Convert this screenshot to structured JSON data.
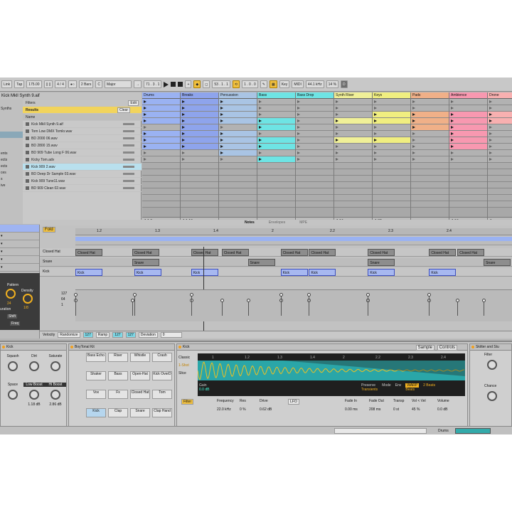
{
  "topbar": {
    "tap": "Tap",
    "tempo": "175.00",
    "sig": "4 / 4",
    "bars": "2 Bars",
    "key_c": "C",
    "scale": "Major",
    "position": "71 . 3 . 1",
    "loop_pos": "53 . 1 . 1",
    "loop_len": "1 . 0 . 0",
    "key_btn": "Key",
    "midi": "MIDI",
    "rate": "44.1 kHz",
    "cpu": "14 %"
  },
  "browser": {
    "file_title": "Kick Mkll Synth 9.aif",
    "filters_label": "Filters",
    "edit_label": "Edit",
    "results_label": "Results",
    "clear_label": "Clear",
    "name_header": "Name",
    "side": [
      "",
      "Synths",
      "",
      "",
      "",
      "",
      "",
      "",
      "ents",
      "ects",
      "ects",
      "ces",
      "s",
      "ive"
    ],
    "files": [
      "Kick Mkll Synth 9.aif",
      "Tom Low DMX Tomlo.wav",
      "BD 2000 06.wav",
      "BD 2800 15.wav",
      "BD 909 Tube Long F 06.wav",
      "Kicky Tom.adv",
      "Kick 909 2.wav",
      "BD Deep Dr Sample 03.wav",
      "Kick 909 Tune11.wav",
      "BD 909 Clean 02.wav"
    ]
  },
  "tracks": [
    {
      "name": "Drums",
      "color": "#9ab2f2",
      "fill": [
        1,
        1,
        1,
        1,
        0,
        1,
        1,
        1,
        0,
        0
      ],
      "footer": "1   1  9"
    },
    {
      "name": "Breaks",
      "color": "#8ea4ec",
      "fill": [
        1,
        1,
        1,
        1,
        1,
        1,
        1,
        1,
        0,
        0
      ],
      "footer": "1   1  16"
    },
    {
      "name": "Percussion",
      "color": "#a9c4e4",
      "fill": [
        1,
        1,
        1,
        1,
        0,
        1,
        1,
        1,
        1,
        0
      ],
      "footer": ""
    },
    {
      "name": "Bass",
      "color": "#6ee4e4",
      "fill": [
        0,
        0,
        0,
        1,
        1,
        0,
        1,
        1,
        0,
        1
      ],
      "footer": ""
    },
    {
      "name": "Bass Drop",
      "color": "#6ee4e4",
      "fill": [
        0,
        0,
        0,
        0,
        0,
        0,
        0,
        0,
        0,
        0
      ],
      "footer": ""
    },
    {
      "name": "Synth Riser",
      "color": "#f0f098",
      "fill": [
        0,
        0,
        0,
        1,
        0,
        0,
        1,
        0,
        0,
        0
      ],
      "footer": "1   64"
    },
    {
      "name": "Keys",
      "color": "#f0ee80",
      "fill": [
        0,
        0,
        1,
        1,
        0,
        0,
        1,
        0,
        0,
        0
      ],
      "footer": "1   32"
    },
    {
      "name": "Pads",
      "color": "#f0b088",
      "fill": [
        0,
        0,
        1,
        1,
        1,
        0,
        0,
        0,
        0,
        0
      ],
      "footer": ""
    },
    {
      "name": "Ambience",
      "color": "#f898b0",
      "fill": [
        0,
        0,
        1,
        1,
        1,
        1,
        1,
        1,
        0,
        0
      ],
      "footer": "1   64"
    },
    {
      "name": "Drone",
      "color": "#f8b0b0",
      "fill": [
        0,
        0,
        1,
        1,
        0,
        0,
        0,
        0,
        0,
        0
      ],
      "footer": "1"
    }
  ],
  "editor": {
    "tabs": [
      "Notes",
      "Envelopes",
      "MPE"
    ],
    "fold": "Fold",
    "ruler": [
      "1.2",
      "1.3",
      "1.4",
      "2",
      "2.2",
      "2.3",
      "2.4"
    ],
    "lanes": [
      "Closed Hat",
      "Snare",
      "Kick"
    ],
    "notes": [
      {
        "lane": 0,
        "t": 0.0,
        "label": "Closed Hat",
        "c": "gray"
      },
      {
        "lane": 0,
        "t": 0.13,
        "label": "Closed Hat",
        "c": "gray"
      },
      {
        "lane": 1,
        "t": 0.13,
        "label": "Snare",
        "c": "gray"
      },
      {
        "lane": 0,
        "t": 0.265,
        "label": "Closed Hat",
        "c": "gray"
      },
      {
        "lane": 0,
        "t": 0.335,
        "label": "Closed Hat",
        "c": "gray"
      },
      {
        "lane": 1,
        "t": 0.395,
        "label": "Snare",
        "c": "gray"
      },
      {
        "lane": 0,
        "t": 0.47,
        "label": "Closed Hat",
        "c": "gray"
      },
      {
        "lane": 0,
        "t": 0.535,
        "label": "Closed Hat",
        "c": "gray"
      },
      {
        "lane": 0,
        "t": 0.67,
        "label": "Closed Hat",
        "c": "gray"
      },
      {
        "lane": 1,
        "t": 0.67,
        "label": "Snare",
        "c": "gray"
      },
      {
        "lane": 0,
        "t": 0.81,
        "label": "Closed Hat",
        "c": "gray"
      },
      {
        "lane": 0,
        "t": 0.875,
        "label": "Closed Hat",
        "c": "gray"
      },
      {
        "lane": 1,
        "t": 0.935,
        "label": "Snare",
        "c": "gray"
      },
      {
        "lane": 2,
        "t": 0.0,
        "label": "Kick",
        "c": "blue"
      },
      {
        "lane": 2,
        "t": 0.135,
        "label": "Kick",
        "c": "blue"
      },
      {
        "lane": 2,
        "t": 0.265,
        "label": "Kick",
        "c": "blue"
      },
      {
        "lane": 2,
        "t": 0.47,
        "label": "Kick",
        "c": "blue"
      },
      {
        "lane": 2,
        "t": 0.535,
        "label": "Kick",
        "c": "blue"
      },
      {
        "lane": 2,
        "t": 0.67,
        "label": "Kick",
        "c": "blue"
      },
      {
        "lane": 2,
        "t": 0.81,
        "label": "Kick",
        "c": "blue"
      }
    ],
    "vel_scale": [
      "127",
      "64",
      "1"
    ],
    "velocity": "Velocity",
    "randomize": "Randomize",
    "rand_val": "127",
    "ramp": "Ramp",
    "ramp_a": "127",
    "ramp_b": "127",
    "deviation": "Deviation",
    "dev_val": "0"
  },
  "left_panel": {
    "pattern": "Pattern",
    "density": "Density",
    "pattern_val": "24",
    "density_val": "1/8",
    "duration": "uration",
    "shift": "Shift",
    "freq": "Freq"
  },
  "devices": {
    "drum": {
      "title": "Kick",
      "labels": [
        "Squash",
        "Dirt",
        "Saturate",
        "Space",
        "Low Boost",
        "Hi Boost"
      ],
      "values": [
        "",
        "",
        "",
        "",
        "1.18 dB",
        "2.86 dB"
      ]
    },
    "rack": {
      "title": "BoyTonal Kit",
      "pads": [
        "Bass Echo",
        "Riser",
        "Whistle",
        "Crash",
        "Shaker",
        "Bass",
        "Open-Hat",
        "Kick OverD",
        "Vox",
        "Fx",
        "Closed Hat",
        "Tom",
        "Kick",
        "Clap",
        "Snare",
        "Clap Hand"
      ]
    },
    "simpler": {
      "title": "Kick",
      "sample_tab": "Sample",
      "controls_tab": "Controls",
      "classic": "Classic",
      "oneshot": "1-Shot",
      "slice": "Slice",
      "gain": "Gain",
      "gain_val": "0.0 dB",
      "preserve": "Preserve",
      "mode": "Mode",
      "env": "Env",
      "transients": "Transients",
      "warp": "WARP",
      "beats": "2 Beats",
      "beats_lbl": "Beats",
      "filter": "Filter",
      "frequency": "Frequency",
      "res": "Res",
      "drive": "Drive",
      "freq_val": "22.0 kHz",
      "res_val": "0 %",
      "drive_val": "0.62 dB",
      "lfo": "LFO",
      "fadein": "Fade In",
      "fadeout": "Fade Out",
      "transp": "Transp",
      "volvel": "Vol < Vel",
      "volume": "Volume",
      "fi_val": "0.00 ms",
      "fo_val": "208 ms",
      "tr_val": "0 st",
      "vv_val": "45 %",
      "vol_val": "0.0 dB",
      "ruler": [
        "1",
        "1.2",
        "1.3",
        "1.4",
        "2",
        "2.2",
        "2.3",
        "2.4"
      ]
    },
    "glue": {
      "title": "Skitter and Stu",
      "labels": [
        "Filter",
        "Chance"
      ]
    }
  },
  "status": {
    "track": "Drums"
  }
}
